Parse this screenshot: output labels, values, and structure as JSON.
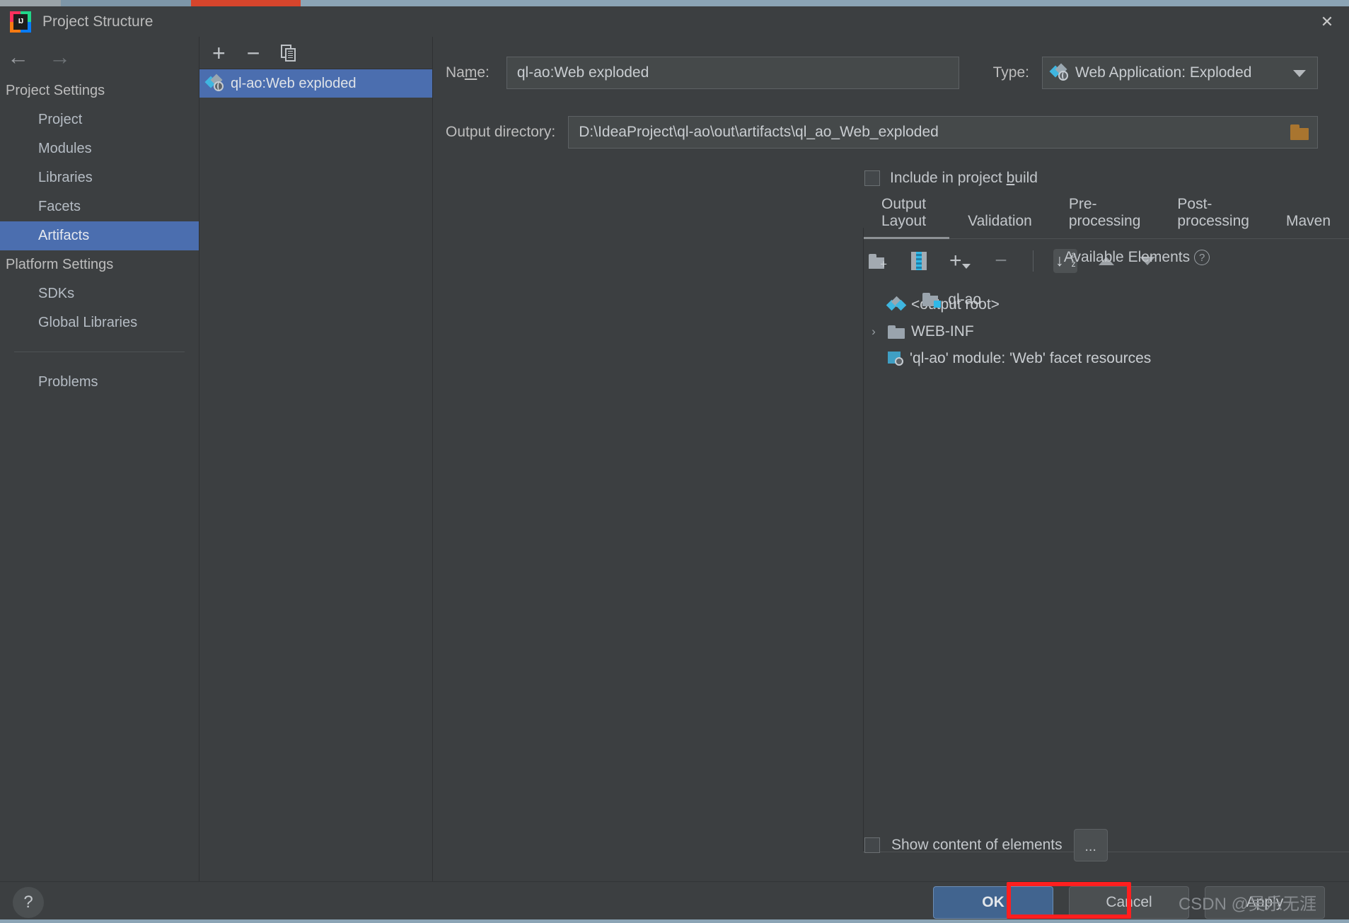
{
  "window": {
    "title": "Project Structure",
    "app_icon": "intellij-idea-icon",
    "close_label": "✕"
  },
  "nav": {
    "back_label": "←",
    "forward_label": "→",
    "groups": [
      {
        "title": "Project Settings",
        "items": [
          {
            "label": "Project",
            "selected": false
          },
          {
            "label": "Modules",
            "selected": false
          },
          {
            "label": "Libraries",
            "selected": false
          },
          {
            "label": "Facets",
            "selected": false
          },
          {
            "label": "Artifacts",
            "selected": true
          }
        ]
      },
      {
        "title": "Platform Settings",
        "items": [
          {
            "label": "SDKs",
            "selected": false
          },
          {
            "label": "Global Libraries",
            "selected": false
          }
        ]
      }
    ],
    "problems_label": "Problems"
  },
  "artifact_list": {
    "toolbar": {
      "add_label": "+",
      "remove_label": "−",
      "copy_name": "copy-icon"
    },
    "items": [
      {
        "label": "ql-ao:Web exploded",
        "selected": true
      }
    ]
  },
  "details": {
    "name_label_pre": "Na",
    "name_label_mnemonic": "m",
    "name_label_post": "e:",
    "name_value": "ql-ao:Web exploded",
    "type_label": "Type:",
    "type_value": "Web Application: Exploded",
    "output_dir_label": "Output directory:",
    "output_dir_value": "D:\\IdeaProject\\ql-ao\\out\\artifacts\\ql_ao_Web_exploded",
    "include_build_pre": "Include in project ",
    "include_build_mnemonic": "b",
    "include_build_post": "uild",
    "include_build_checked": false
  },
  "tabs": [
    {
      "label": "Output Layout",
      "active": true
    },
    {
      "label": "Validation",
      "active": false
    },
    {
      "label": "Pre-processing",
      "active": false
    },
    {
      "label": "Post-processing",
      "active": false
    },
    {
      "label": "Maven",
      "active": false
    }
  ],
  "layout_toolbar": [
    {
      "name": "new-folder-icon",
      "active": false
    },
    {
      "name": "new-archive-icon",
      "active": false
    },
    {
      "name": "add-dropdown-icon",
      "active": false
    },
    {
      "name": "remove-icon",
      "active": false
    },
    {
      "name": "sort-alphabetically-icon",
      "active": true
    },
    {
      "name": "move-up-icon",
      "active": false
    },
    {
      "name": "move-down-icon",
      "active": false
    }
  ],
  "output_tree": [
    {
      "label": "<output root>",
      "icon": "output-root-icon",
      "expandable": false,
      "indent": 0
    },
    {
      "label": "WEB-INF",
      "icon": "folder-icon",
      "expandable": true,
      "expander": "›",
      "indent": 0
    },
    {
      "label": "'ql-ao' module: 'Web' facet resources",
      "icon": "facet-resources-icon",
      "expandable": false,
      "indent": 1
    }
  ],
  "available": {
    "header": "Available Elements",
    "help_glyph": "?",
    "items": [
      {
        "label": "ql-ao",
        "icon": "module-folder-icon"
      }
    ]
  },
  "bottom": {
    "show_content_label": "Show content of elements",
    "show_content_checked": false,
    "ellipsis_label": "..."
  },
  "footer": {
    "help_glyph": "?",
    "ok_label": "OK",
    "cancel_label": "Cancel",
    "apply_label": "Apply",
    "watermark": "CSDN @吴乐无涯"
  }
}
